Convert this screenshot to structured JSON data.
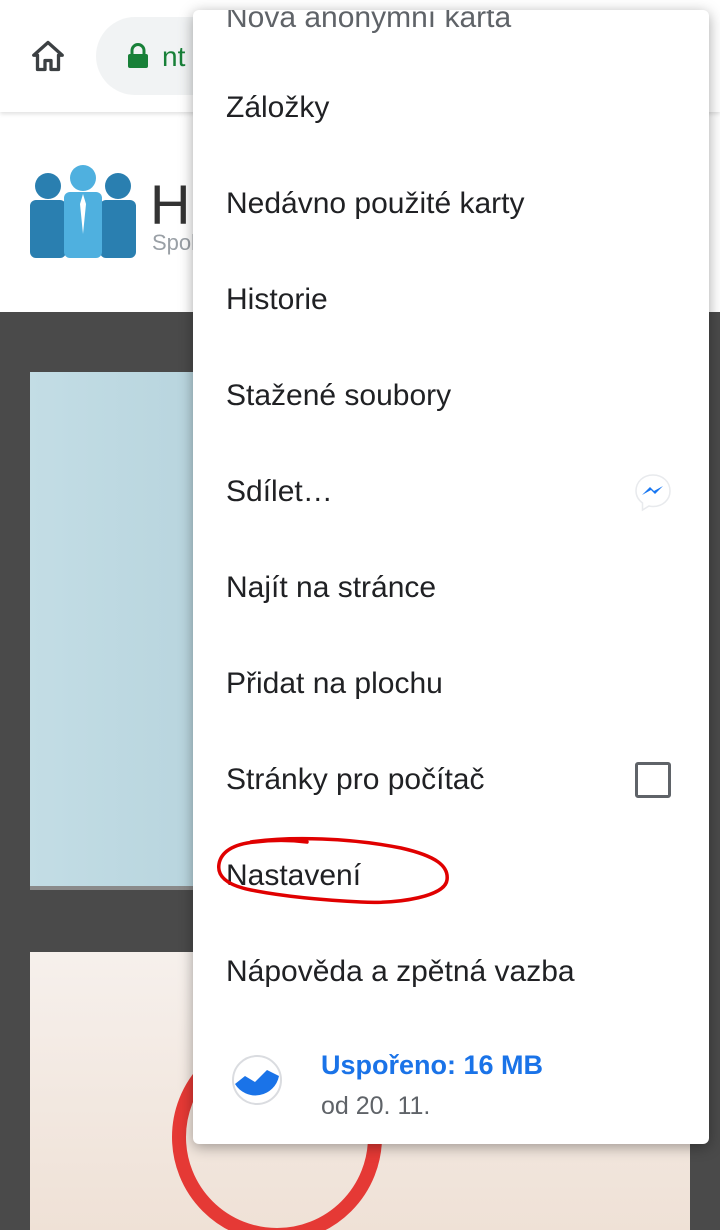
{
  "toolbar": {
    "url_fragment": "nt"
  },
  "site": {
    "logo_title": "Hi",
    "logo_subtitle": "Spol"
  },
  "menu": {
    "items": [
      {
        "label": "Nová anonymní karta"
      },
      {
        "label": "Záložky"
      },
      {
        "label": "Nedávno použité karty"
      },
      {
        "label": "Historie"
      },
      {
        "label": "Stažené soubory"
      },
      {
        "label": "Sdílet…"
      },
      {
        "label": "Najít na stránce"
      },
      {
        "label": "Přidat na plochu"
      },
      {
        "label": "Stránky pro počítač",
        "checked": false
      },
      {
        "label": "Nastavení"
      },
      {
        "label": "Nápověda a zpětná vazba"
      }
    ],
    "savings": {
      "title": "Uspořeno: 16 MB",
      "subtitle": "od 20. 11."
    }
  },
  "colors": {
    "accent": "#1a73e8",
    "lock": "#188038",
    "annotation": "#e00000",
    "messenger": "#1877f2"
  },
  "icons": [
    "home-icon",
    "lock-icon",
    "messenger-icon",
    "data-saver-icon"
  ]
}
